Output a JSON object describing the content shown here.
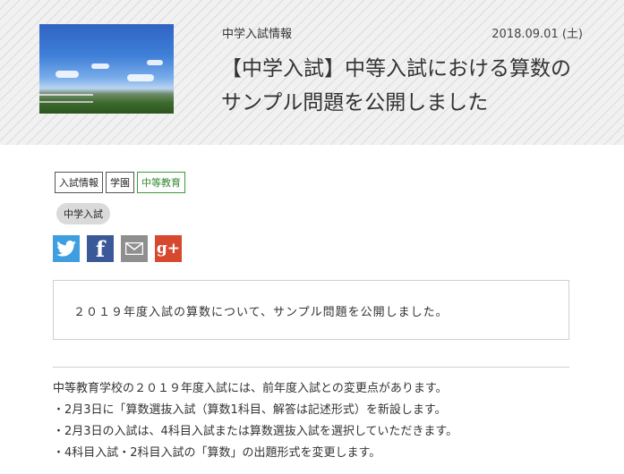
{
  "post": {
    "category": "中学入試情報",
    "date": "2018.09.01 (土)",
    "title": "【中学入試】中等入試における算数のサンプル問題を公開しました"
  },
  "tags": [
    "入試情報",
    "学園",
    "中等教育"
  ],
  "pill_tag": "中学入試",
  "share": {
    "icons": [
      "twitter-icon",
      "facebook-icon",
      "mail-icon",
      "google-plus-icon"
    ],
    "facebook_glyph": "f",
    "gplus_glyph": "g+"
  },
  "lead": "２０１９年度入試の算数について、サンプル問題を公開しました。",
  "body": {
    "lines": [
      "中等教育学校の２０１９年度入試には、前年度入試との変更点があります。",
      "・2月3日に「算数選抜入試（算数1科目、解答は記述形式）を新設します。",
      "・2月3日の入試は、4科目入試または算数選抜入試を選択していただきます。",
      "・4科目入試・2科目入試の「算数」の出題形式を変更します。"
    ]
  },
  "colors": {
    "twitter": "#3e9ee0",
    "facebook": "#3b5998",
    "mail": "#8f8f8f",
    "gplus": "#d6492f",
    "tag_green": "#3c9a3c"
  }
}
